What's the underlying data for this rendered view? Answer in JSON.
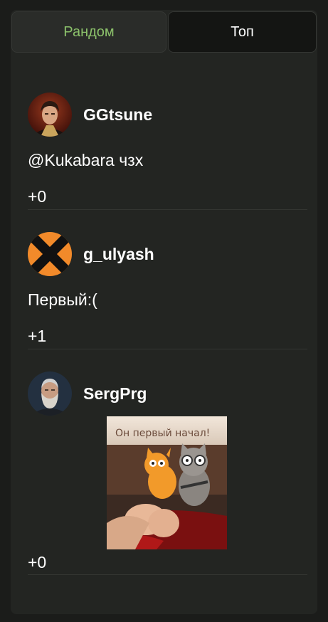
{
  "tabs": {
    "random_label": "Рандом",
    "top_label": "Топ",
    "active": "random"
  },
  "colors": {
    "accent": "#8cc26b",
    "panel": "#232522",
    "background": "#1b1c1a"
  },
  "comments": [
    {
      "username": "GGtsune",
      "text": "@Kukabara чзх",
      "score": "+0",
      "avatar": "portrait-avatar"
    },
    {
      "username": "g_ulyash",
      "text": "Первый:(",
      "score": "+1",
      "avatar": "orange-x-avatar"
    },
    {
      "username": "SergPrg",
      "text": "",
      "score": "+0",
      "avatar": "bearded-man-avatar",
      "image": {
        "caption": "Он первый начал!"
      }
    }
  ]
}
